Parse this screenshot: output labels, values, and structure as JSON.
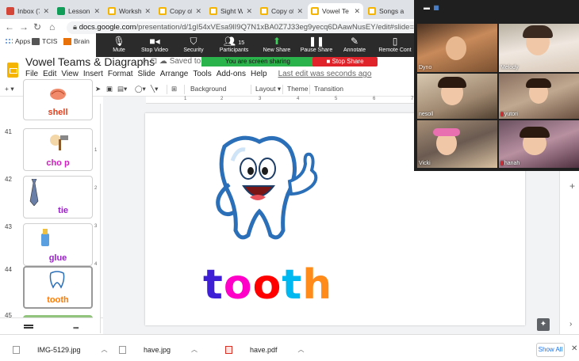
{
  "browser": {
    "tabs": [
      {
        "title": "Inbox (7"
      },
      {
        "title": "Lesson P"
      },
      {
        "title": "Workshe"
      },
      {
        "title": "Copy of"
      },
      {
        "title": "Sight Wo"
      },
      {
        "title": "Copy of"
      },
      {
        "title": "Vowel Te"
      },
      {
        "title": "Songs a"
      }
    ],
    "url_host": "docs.google.com",
    "url_path": "/presentation/d/1gI54xVEsa9lI9Q7N1xBA0Z7J33eg9yecq6DAawNusEY/edit#slide=id.gdb45ea8",
    "bookmarks": [
      "Apps",
      "TCIS",
      "Brain"
    ]
  },
  "zoom": {
    "controls": [
      "Mute",
      "Stop Video",
      "Security",
      "Participants",
      "New Share",
      "Pause Share",
      "Annotate",
      "Remote Cont"
    ],
    "participants_count": "15",
    "sharing_notice": "You are screen sharing",
    "stop_share": "Stop Share",
    "gallery": [
      {
        "name": "Dyno",
        "muted": false
      },
      {
        "name": "Melody",
        "muted": false
      },
      {
        "name": "nesoll",
        "muted": false
      },
      {
        "name": "yutori",
        "muted": true
      },
      {
        "name": "Vicki",
        "muted": false
      },
      {
        "name": "hanah",
        "muted": true
      }
    ]
  },
  "slides": {
    "title": "Vowel Teams & Diagraphs",
    "saved_status": "Saved to",
    "menu": [
      "File",
      "Edit",
      "View",
      "Insert",
      "Format",
      "Slide",
      "Arrange",
      "Tools",
      "Add-ons",
      "Help"
    ],
    "last_edit": "Last edit was seconds ago",
    "toolbar": {
      "background": "Background",
      "layout": "Layout",
      "theme": "Theme",
      "transition": "Transition"
    },
    "ruler_top": [
      "1",
      "2",
      "3",
      "4",
      "5",
      "6",
      "7"
    ],
    "ruler_left": [
      "1",
      "2",
      "3",
      "4"
    ],
    "thumbnails": [
      {
        "number": "",
        "word": "shell",
        "color": "#e0401e"
      },
      {
        "number": "41",
        "word": "cho p",
        "color": "#d020c0"
      },
      {
        "number": "42",
        "word": "tie",
        "color": "#9a20c8"
      },
      {
        "number": "43",
        "word": "glue",
        "color": "#9a20c8"
      },
      {
        "number": "44",
        "word": "tooth",
        "color": "#ff7a00"
      },
      {
        "number": "45",
        "word": "",
        "color": "#6aa84f"
      }
    ],
    "current_slide_word": [
      "t",
      "o",
      "o",
      "t",
      "h"
    ],
    "current_slide_colors": [
      "#3f1fd6",
      "#ff00c8",
      "#ff0000",
      "#00b8f0",
      "#ff8c1a"
    ]
  },
  "downloads": [
    {
      "name": "IMG-5129.jpg",
      "type": "image"
    },
    {
      "name": "have.jpg",
      "type": "image"
    },
    {
      "name": "have.pdf",
      "type": "pdf"
    }
  ],
  "downloads_show_all": "Show All"
}
